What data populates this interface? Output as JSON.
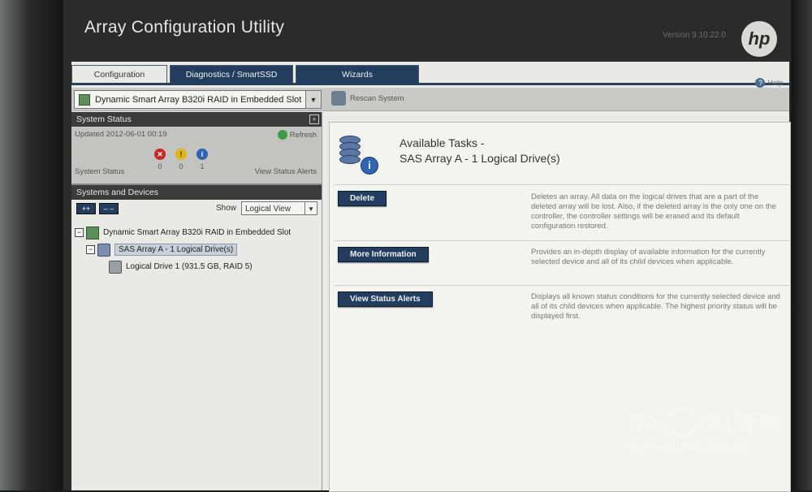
{
  "app": {
    "title": "Array Configuration Utility",
    "version": "Version 9.10.22.0",
    "logo_text": "hp"
  },
  "tabs": [
    {
      "label": "Configuration",
      "active": true
    },
    {
      "label": "Diagnostics / SmartSSD",
      "active": false
    },
    {
      "label": "Wizards",
      "active": false
    }
  ],
  "help": {
    "label": "Help"
  },
  "device_selector": {
    "value": "Dynamic Smart Array B320i RAID in Embedded Slot",
    "rescan_label": "Rescan System"
  },
  "system_status": {
    "header": "System Status",
    "expand_glyph": "+",
    "updated": "Updated 2012-06-01 00:19",
    "refresh_label": "Refresh",
    "label": "System Status",
    "counts": [
      {
        "type": "error",
        "glyph": "✕",
        "value": "0",
        "color": "#c72626"
      },
      {
        "type": "warning",
        "glyph": "!",
        "value": "0",
        "color": "#e0b515"
      },
      {
        "type": "info",
        "glyph": "i",
        "value": "1",
        "color": "#2f64b0"
      }
    ],
    "view_alerts_label": "View Status Alerts"
  },
  "systems_devices": {
    "header": "Systems and Devices",
    "expand_all": "++",
    "collapse_all": "– –",
    "show_label": "Show",
    "view_select": "Logical View",
    "tree": [
      {
        "level": 0,
        "expander": "−",
        "icon": "controller-icon",
        "label": "Dynamic Smart Array B320i RAID in Embedded Slot",
        "selected": false
      },
      {
        "level": 1,
        "expander": "−",
        "icon": "array-icon",
        "label": "SAS Array A - 1 Logical Drive(s)",
        "selected": true
      },
      {
        "level": 2,
        "expander": "",
        "icon": "logical-drive-icon",
        "label": "Logical Drive 1 (931.5 GB, RAID 5)",
        "selected": false
      }
    ]
  },
  "tasks": {
    "title_line1": "Available Tasks -",
    "title_line2": "SAS Array A - 1 Logical Drive(s)",
    "items": [
      {
        "label": "Delete",
        "description": "Deletes an array. All data on the logical drives that are a part of the deleted array will be lost. Also, if the deleted array is the only one on the controller, the controller settings will be erased and its default configuration restored."
      },
      {
        "label": "More Information",
        "description": "Provides an in-depth display of available information for the currently selected device and all of its child devices when applicable."
      },
      {
        "label": "View Status Alerts",
        "description": "Displays all known status conditions for the currently selected device and all of its child devices when applicable. The highest priority status will be displayed first."
      }
    ]
  },
  "watermark": {
    "brand_left": "Bai",
    "brand_right": "du",
    "brand_cn": "经验",
    "url": "jingyan.baidu.com"
  },
  "colors": {
    "tab_active_bg": "#e9eae5",
    "tab_inactive_bg": "#223d5e",
    "button_bg": "#223d5e",
    "header_bg": "#3b3c3a"
  }
}
